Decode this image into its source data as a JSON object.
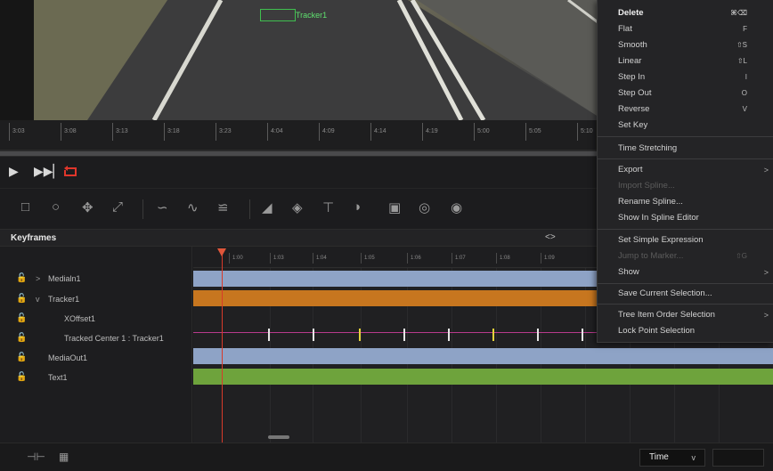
{
  "viewer": {
    "tracker_label": "Tracker1"
  },
  "ruler": {
    "ticks": [
      "3:03",
      "3:08",
      "3:13",
      "3:18",
      "3:23",
      "4:04",
      "4:09",
      "4:14",
      "4:19",
      "5:00",
      "5:05",
      "5:10"
    ]
  },
  "transport": {
    "play_icon": "play-icon",
    "next_icon": "skip-next-icon",
    "loop_icon": "loop-icon",
    "loop_color": "#e0362b"
  },
  "keyframes": {
    "title": "Keyframes",
    "nav_arrows": "<>",
    "timeline_ticks": [
      "1:00",
      "1:03",
      "1:04",
      "1:05",
      "1:06",
      "1:07",
      "1:08",
      "1:09"
    ],
    "tracks": [
      {
        "name": "Medialn1",
        "expander": ">"
      },
      {
        "name": "Tracker1",
        "expander": "v"
      },
      {
        "name": "XOffset1",
        "expander": ""
      },
      {
        "name": "Tracked Center 1 : Tracker1",
        "expander": ""
      },
      {
        "name": "MediaOut1",
        "expander": ""
      },
      {
        "name": "Text1",
        "expander": ""
      }
    ],
    "bar_colors": {
      "blue": "#8ea3c6",
      "orange": "#c7761f",
      "green": "#6ea33c",
      "spline": "#b83a8c",
      "playhead": "#d83a2a"
    }
  },
  "bottombar": {
    "time_select": "Time",
    "time_caret": "v"
  },
  "context_menu": {
    "items": [
      {
        "label": "Delete",
        "shortcut": "⌘⌫",
        "bold": true
      },
      {
        "label": "Flat",
        "shortcut": "F"
      },
      {
        "label": "Smooth",
        "shortcut": "⇧S"
      },
      {
        "label": "Linear",
        "shortcut": "⇧L"
      },
      {
        "label": "Step In",
        "shortcut": "I"
      },
      {
        "label": "Step Out",
        "shortcut": "O"
      },
      {
        "label": "Reverse",
        "shortcut": "V"
      },
      {
        "label": "Set Key",
        "shortcut": ""
      },
      {
        "label": "Time Stretching",
        "shortcut": ""
      },
      {
        "label": "Export",
        "shortcut": "",
        "submenu": ">"
      },
      {
        "label": "Import Spline...",
        "shortcut": "",
        "disabled": true
      },
      {
        "label": "Rename Spline...",
        "shortcut": ""
      },
      {
        "label": "Show In Spline Editor",
        "shortcut": ""
      },
      {
        "label": "Set Simple Expression",
        "shortcut": ""
      },
      {
        "label": "Jump to Marker...",
        "shortcut": "⇧G",
        "disabled": true
      },
      {
        "label": "Show",
        "shortcut": "",
        "submenu": ">"
      },
      {
        "label": "Save Current Selection...",
        "shortcut": ""
      },
      {
        "label": "Tree Item Order Selection",
        "shortcut": "",
        "submenu": ">"
      },
      {
        "label": "Lock Point Selection",
        "shortcut": ""
      }
    ]
  }
}
